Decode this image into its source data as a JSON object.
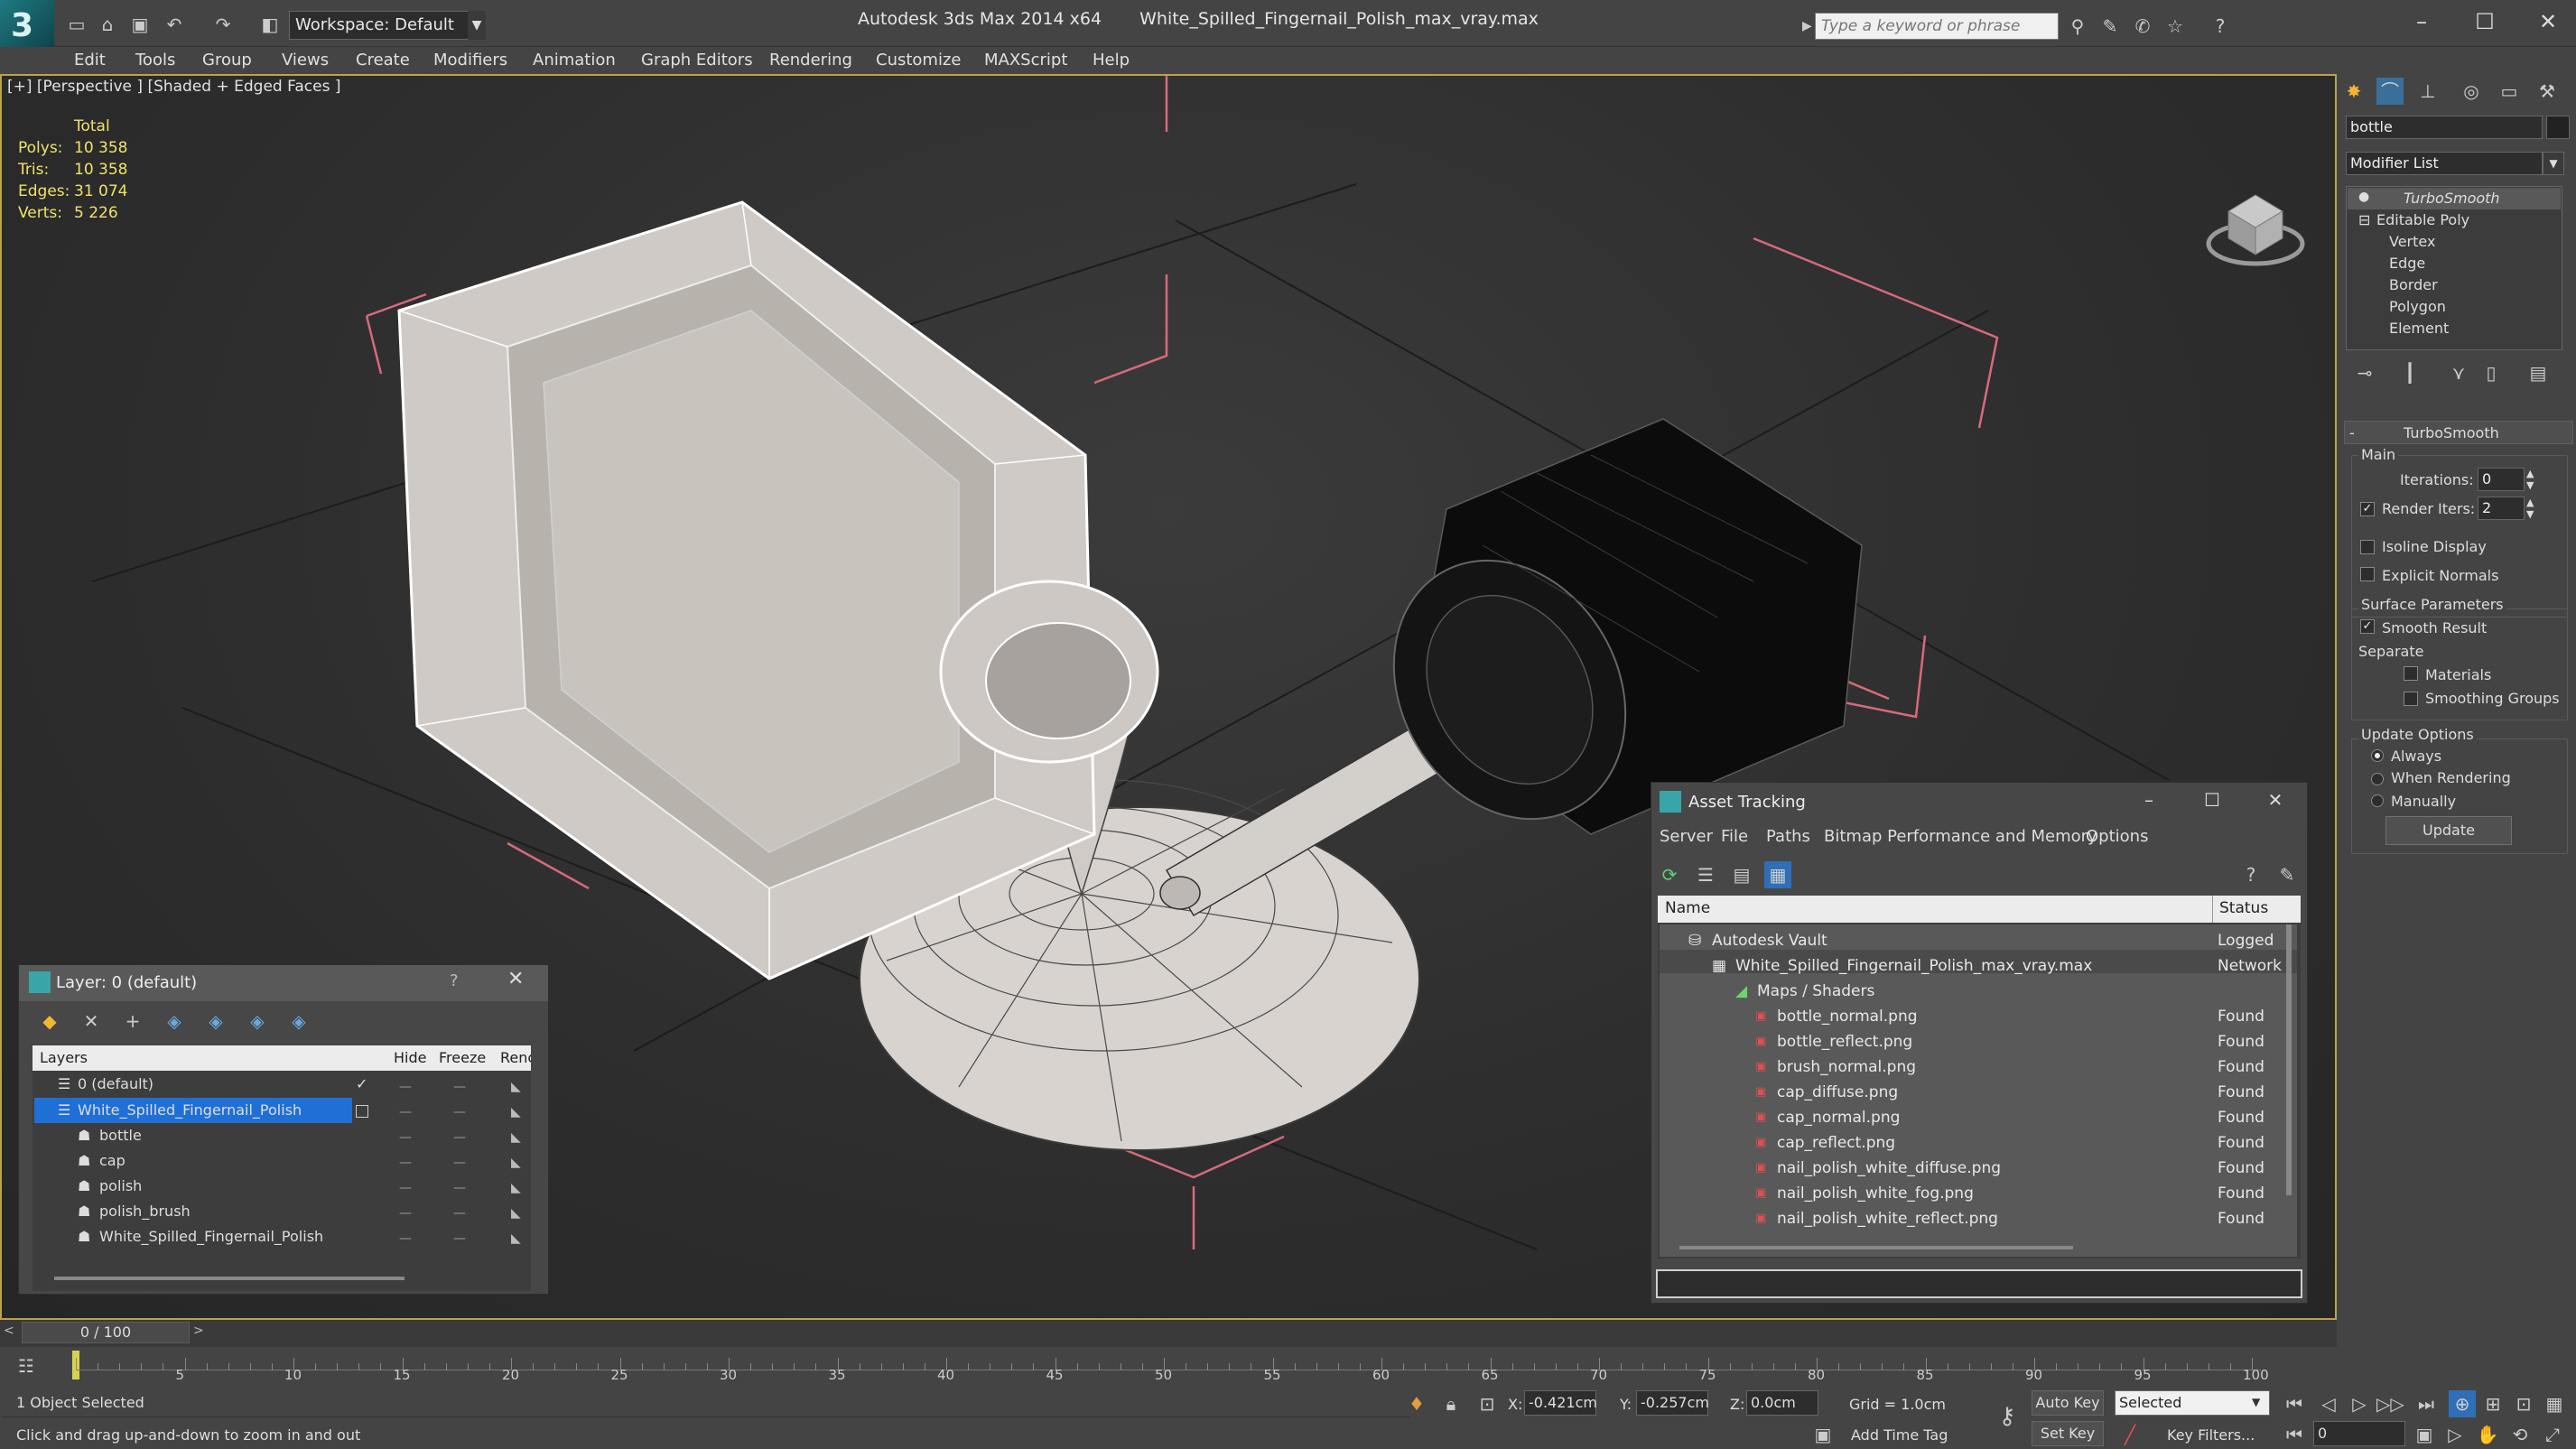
{
  "titlebar": {
    "workspace_label": "Workspace: Default",
    "app_name": "Autodesk 3ds Max  2014 x64",
    "file_name": "White_Spilled_Fingernail_Polish_max_vray.max",
    "search_placeholder": "Type a keyword or phrase"
  },
  "menu": [
    "Edit",
    "Tools",
    "Group",
    "Views",
    "Create",
    "Modifiers",
    "Animation",
    "Graph Editors",
    "Rendering",
    "Customize",
    "MAXScript",
    "Help"
  ],
  "viewport": {
    "label": "[+] [Perspective ] [Shaded + Edged Faces ]",
    "stats_header": "Total",
    "stats": [
      {
        "label": "Polys:",
        "value": "10 358"
      },
      {
        "label": "Tris:",
        "value": "10 358"
      },
      {
        "label": "Edges:",
        "value": "31 074"
      },
      {
        "label": "Verts:",
        "value": "5 226"
      }
    ]
  },
  "command_panel": {
    "object_name": "bottle",
    "modifier_list": "Modifier List",
    "stack": [
      "TurboSmooth",
      "Editable Poly",
      "Vertex",
      "Edge",
      "Border",
      "Polygon",
      "Element"
    ],
    "rollout_title": "TurboSmooth",
    "main_label": "Main",
    "iterations_label": "Iterations:",
    "iterations_value": "0",
    "render_iters_label": "Render Iters:",
    "render_iters_value": "2",
    "isoline_label": "Isoline Display",
    "explicit_normals_label": "Explicit Normals",
    "surface_params_label": "Surface Parameters",
    "smooth_result_label": "Smooth Result",
    "separate_label": "Separate",
    "materials_label": "Materials",
    "smoothing_groups_label": "Smoothing Groups",
    "update_options_label": "Update Options",
    "always_label": "Always",
    "when_rendering_label": "When Rendering",
    "manually_label": "Manually",
    "update_button": "Update"
  },
  "layer_window": {
    "title": "Layer: 0 (default)",
    "help": "?",
    "columns": [
      "Layers",
      "Hide",
      "Freeze",
      "Renc"
    ],
    "rows": [
      {
        "name": "0 (default)"
      },
      {
        "name": "White_Spilled_Fingernail_Polish"
      },
      {
        "name": "bottle"
      },
      {
        "name": "cap"
      },
      {
        "name": "polish"
      },
      {
        "name": "polish_brush"
      },
      {
        "name": "White_Spilled_Fingernail_Polish"
      }
    ]
  },
  "asset_window": {
    "title": "Asset Tracking",
    "menu": [
      "Server",
      "File",
      "Paths",
      "Bitmap Performance and Memory",
      "Options"
    ],
    "columns": [
      "Name",
      "Status"
    ],
    "rows": [
      {
        "name": "Autodesk Vault",
        "status": "Logged"
      },
      {
        "name": "White_Spilled_Fingernail_Polish_max_vray.max",
        "status": "Network"
      },
      {
        "name": "Maps / Shaders",
        "status": ""
      },
      {
        "name": "bottle_normal.png",
        "status": "Found"
      },
      {
        "name": "bottle_reflect.png",
        "status": "Found"
      },
      {
        "name": "brush_normal.png",
        "status": "Found"
      },
      {
        "name": "cap_diffuse.png",
        "status": "Found"
      },
      {
        "name": "cap_normal.png",
        "status": "Found"
      },
      {
        "name": "cap_reflect.png",
        "status": "Found"
      },
      {
        "name": "nail_polish_white_diffuse.png",
        "status": "Found"
      },
      {
        "name": "nail_polish_white_fog.png",
        "status": "Found"
      },
      {
        "name": "nail_polish_white_reflect.png",
        "status": "Found"
      }
    ]
  },
  "timeline": {
    "frame_label": "0 / 100",
    "ticks": [
      "5",
      "10",
      "15",
      "20",
      "25",
      "30",
      "35",
      "40",
      "45",
      "50",
      "55",
      "60",
      "65",
      "70",
      "75",
      "80",
      "85",
      "90",
      "95",
      "100"
    ]
  },
  "status": {
    "selection": "1 Object Selected",
    "prompt": "Click and drag up-and-down to zoom in and out",
    "x_label": "X:",
    "x_value": "-0.421cm",
    "y_label": "Y:",
    "y_value": "-0.257cm",
    "z_label": "Z:",
    "z_value": "0.0cm",
    "grid": "Grid = 1.0cm",
    "add_time_tag": "Add Time Tag",
    "auto_key": "Auto Key",
    "set_key": "Set Key",
    "selected_dropdown": "Selected",
    "key_filters": "Key Filters...",
    "frame_value": "0"
  },
  "colors": {
    "selection_highlight": "#1f6fd6",
    "viewport_border": "#b9a44a",
    "stats_yellow": "#f0e26e"
  }
}
